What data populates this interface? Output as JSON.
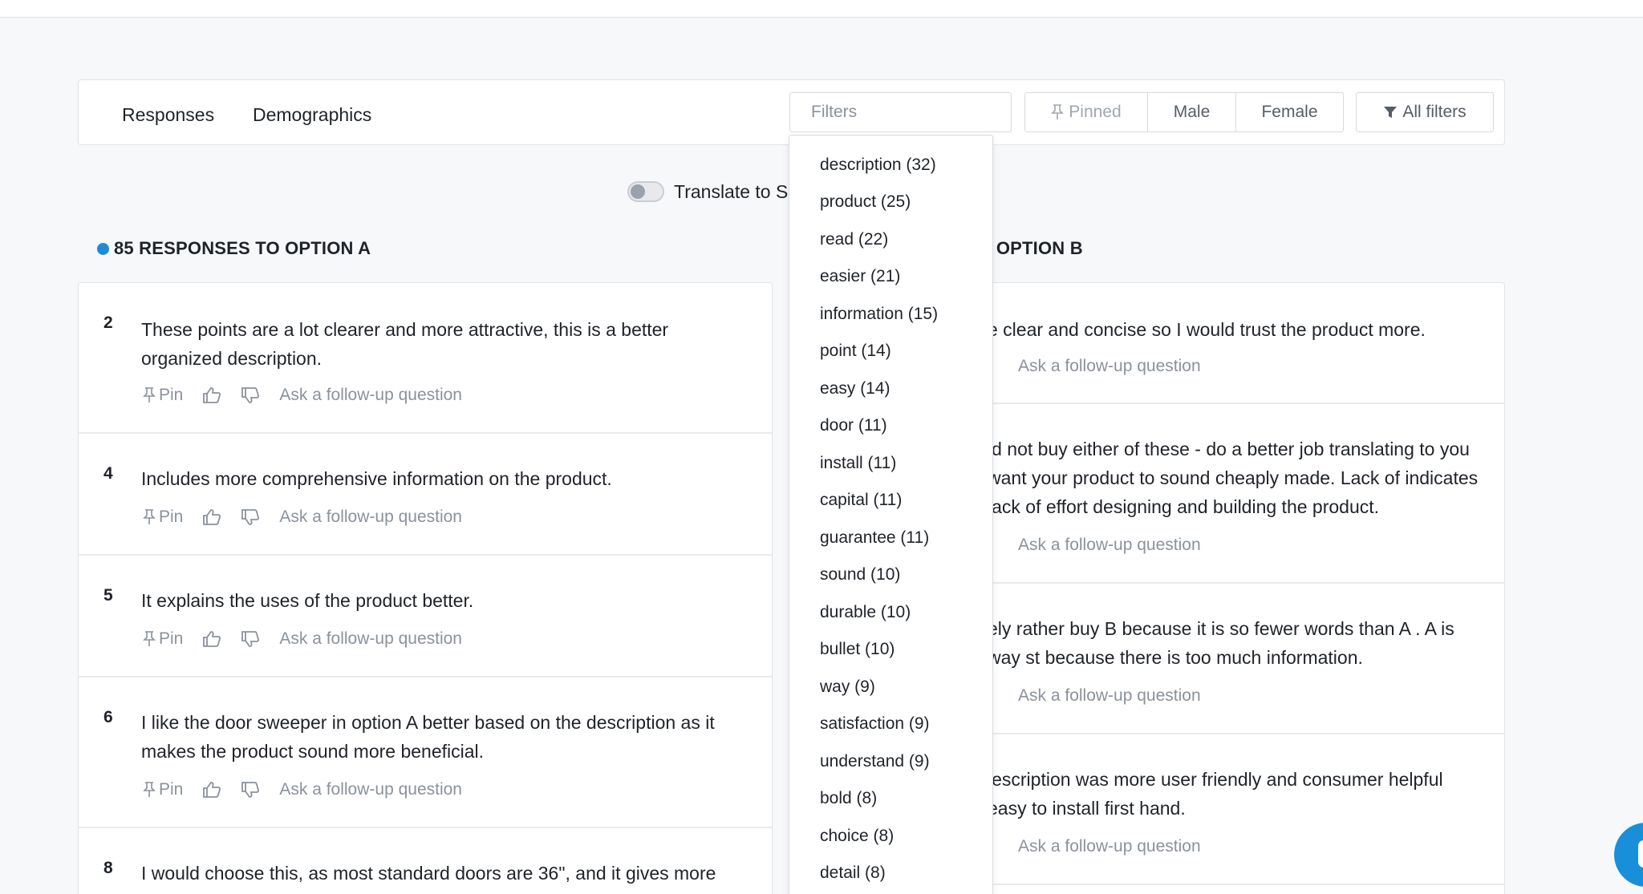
{
  "tabs": [
    {
      "label": "Responses"
    },
    {
      "label": "Demographics"
    }
  ],
  "filters": {
    "placeholder": "Filters",
    "pinned_label": "Pinned",
    "male_label": "Male",
    "female_label": "Female",
    "all_filters_label": "All filters"
  },
  "translate": {
    "label": "Translate to Si"
  },
  "option_a": {
    "title": "85 RESPONSES TO OPTION A",
    "accent": "#1f8ad6",
    "responses": [
      {
        "num": "2",
        "text": "These points are a lot clearer and more attractive, this is a better organized description."
      },
      {
        "num": "4",
        "text": "Includes more comprehensive information on the product."
      },
      {
        "num": "5",
        "text": "It explains the uses of the product better."
      },
      {
        "num": "6",
        "text": "I like the door sweeper in option A better based on the description as it makes the product sound more beneficial."
      },
      {
        "num": "8",
        "text": "I would choose this, as most standard doors are 36\", and it gives more"
      }
    ]
  },
  "option_b": {
    "title": ") OPTION B",
    "responses": [
      {
        "text": "e clear and concise so I would trust the product more."
      },
      {
        "text": "ld not buy either of these - do a better job translating to you want your product to sound cheaply made. Lack of indicates lack of effort designing and building the product."
      },
      {
        "text": "ely rather buy B because it is so fewer words than A . A is way st because there is too much information."
      },
      {
        "text": "lescription was more user friendly and consumer helpful easy to install first hand."
      }
    ]
  },
  "actions": {
    "pin": "Pin",
    "follow_up": "Ask a follow-up question"
  },
  "keywords": [
    "description (32)",
    "product (25)",
    "read (22)",
    "easier (21)",
    "information (15)",
    "point (14)",
    "easy (14)",
    "door (11)",
    "install (11)",
    "capital (11)",
    "guarantee (11)",
    "sound (10)",
    "durable (10)",
    "bullet (10)",
    "way (9)",
    "satisfaction (9)",
    "understand (9)",
    "bold (8)",
    "choice (8)",
    "detail (8)"
  ]
}
